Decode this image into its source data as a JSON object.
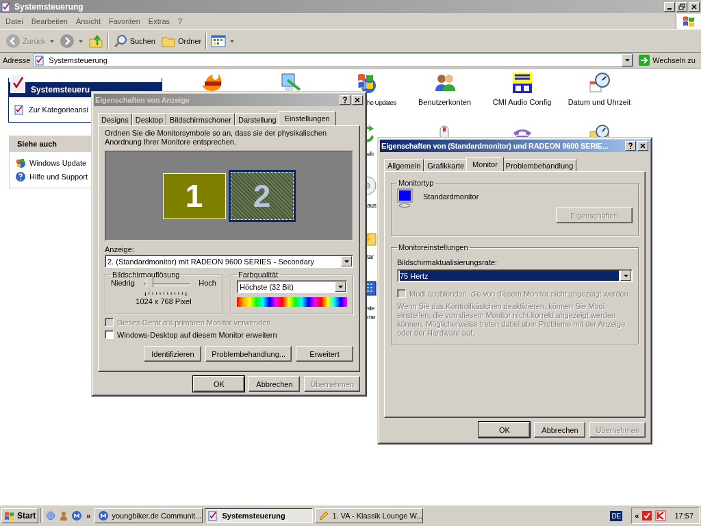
{
  "explorer": {
    "title": "Systemsteuerung",
    "menu": [
      "Datei",
      "Bearbeiten",
      "Ansicht",
      "Favoriten",
      "Extras",
      "?"
    ],
    "toolbar": [
      {
        "kind": "back",
        "label": "Zurück",
        "disabled": true
      },
      {
        "kind": "forward"
      },
      {
        "kind": "up"
      },
      {
        "kind": "search",
        "label": "Suchen"
      },
      {
        "kind": "folders",
        "label": "Ordner"
      },
      {
        "kind": "views"
      }
    ],
    "address": {
      "label": "Adresse",
      "value": "Systemsteuerung",
      "go": "Wechseln zu"
    }
  },
  "sidebar": {
    "header": "Systemsteueru",
    "link": "Zur Kategorieansi",
    "see_also": {
      "title": "Siehe auch",
      "links": [
        {
          "kind": "update",
          "label": "Windows Update"
        },
        {
          "kind": "help",
          "label": "Hilfe und Support"
        }
      ]
    }
  },
  "icon_columns": [
    {
      "kind": "full",
      "items": [
        {
          "kind": "flame"
        }
      ]
    },
    {
      "kind": "full",
      "items": [
        {
          "kind": "monitor-pen"
        }
      ]
    },
    {
      "kind": "cut",
      "items": [
        {
          "kind": "flag",
          "lines": [
            "he Updates"
          ]
        },
        {
          "kind": "arrows",
          "lines": [
            "eh"
          ]
        },
        {
          "kind": "disc",
          "lines": [
            "aus"
          ]
        },
        {
          "kind": "folder",
          "lines": [
            "tar"
          ]
        },
        {
          "kind": "keyboard",
          "lines": [
            "ste",
            "me"
          ]
        }
      ]
    },
    {
      "kind": "full",
      "items": [
        {
          "kind": "users",
          "lines": [
            "Benutzerkonten"
          ]
        },
        {
          "kind": "mouse"
        }
      ]
    },
    {
      "kind": "full",
      "items": [
        {
          "kind": "blocks",
          "lines": [
            "CMI Audio Config"
          ]
        },
        {
          "kind": "phone"
        }
      ]
    },
    {
      "kind": "full",
      "items": [
        {
          "kind": "clock",
          "lines": [
            "Datum und Uhrzeit"
          ]
        },
        {
          "kind": "folder-clock"
        }
      ]
    }
  ],
  "display_dialog": {
    "title": "Eigenschaften von Anzeige",
    "active": false,
    "tabs": [
      {
        "label": "Designs",
        "selected": false
      },
      {
        "label": "Desktop",
        "selected": false
      },
      {
        "label": "Bildschirmschoner",
        "selected": false
      },
      {
        "label": "Darstellung",
        "selected": false
      },
      {
        "label": "Einstellungen",
        "selected": true
      }
    ],
    "description": "Ordnen Sie die Monitorsymbole so an, dass sie der physikalischen Anordnung Ihrer Monitore entsprechen.",
    "monitors": [
      {
        "label": "1",
        "selected": false
      },
      {
        "label": "2",
        "selected": true
      }
    ],
    "display_label": "Anzeige:",
    "display_value": "2. (Standardmonitor) mit RADEON 9600 SERIES - Secondary",
    "resolution": {
      "title": "Bildschirmauflösung",
      "low": "Niedrig",
      "high": "Hoch",
      "level": 0.08,
      "reading": "1024 x 768 Pixel"
    },
    "color_quality": {
      "title": "Farbqualität",
      "value": "Höchste (32 Bit)"
    },
    "checkboxes": [
      {
        "label": "Dieses Gerät als primären Monitor verwenden",
        "checked": false,
        "disabled": true
      },
      {
        "label": "Windows-Desktop auf diesem Monitor erweitern",
        "checked": false,
        "disabled": false
      }
    ],
    "panel_buttons": [
      {
        "label": "Identifizieren"
      },
      {
        "label": "Problembehandlung..."
      },
      {
        "label": "Erweitert"
      }
    ],
    "buttons": [
      {
        "label": "OK",
        "disabled": false,
        "default": true
      },
      {
        "label": "Abbrechen",
        "disabled": false,
        "default": false
      },
      {
        "label": "Übernehmen",
        "disabled": true,
        "default": false
      }
    ]
  },
  "monitor_dialog": {
    "title": "Eigenschaften von (Standardmonitor) und RADEON 9600 SERIE...",
    "active": true,
    "tabs": [
      {
        "label": "Allgemein",
        "selected": false
      },
      {
        "label": "Grafikkarte",
        "selected": false
      },
      {
        "label": "Monitor",
        "selected": true
      },
      {
        "label": "Problembehandlung",
        "selected": false
      }
    ],
    "monitor_type": {
      "title": "Monitortyp",
      "name": "Standardmonitor",
      "button": {
        "label": "Eigenschaften",
        "disabled": true
      }
    },
    "settings": {
      "title": "Monitoreinstellungen",
      "rate_label": "Bildschirmaktualisierungsrate:",
      "rate_value": "75 Hertz",
      "checkbox": {
        "label": "Modi ausblenden, die von diesem Monitor nicht angezeigt werden",
        "checked": false,
        "disabled": true
      },
      "note": "Wenn Sie das Kontrollkästchen deaktivieren, können Sie Modi einstellen, die von diesem Monitor nicht korrekt angezeigt werden können. Möglicherweise treten dabei aber Probleme mit der Anzeige oder der Hardware auf.",
      "note_disabled": true
    },
    "buttons": [
      {
        "label": "OK",
        "disabled": false,
        "default": true
      },
      {
        "label": "Abbrechen",
        "disabled": false,
        "default": false
      },
      {
        "label": "Übernehmen",
        "disabled": true,
        "default": false
      }
    ]
  },
  "taskbar": {
    "start": "Start",
    "more": "»",
    "tasks": [
      {
        "kind": "messenger",
        "label": "youngbiker.de Communit...",
        "selected": false
      },
      {
        "kind": "control-panel",
        "label": "Systemsteuerung",
        "selected": true
      },
      {
        "kind": "player",
        "label": "1. VA - Klassik Lounge W...",
        "selected": false
      }
    ],
    "language": "DE",
    "tray_expand": "«",
    "clock": "17:57"
  }
}
